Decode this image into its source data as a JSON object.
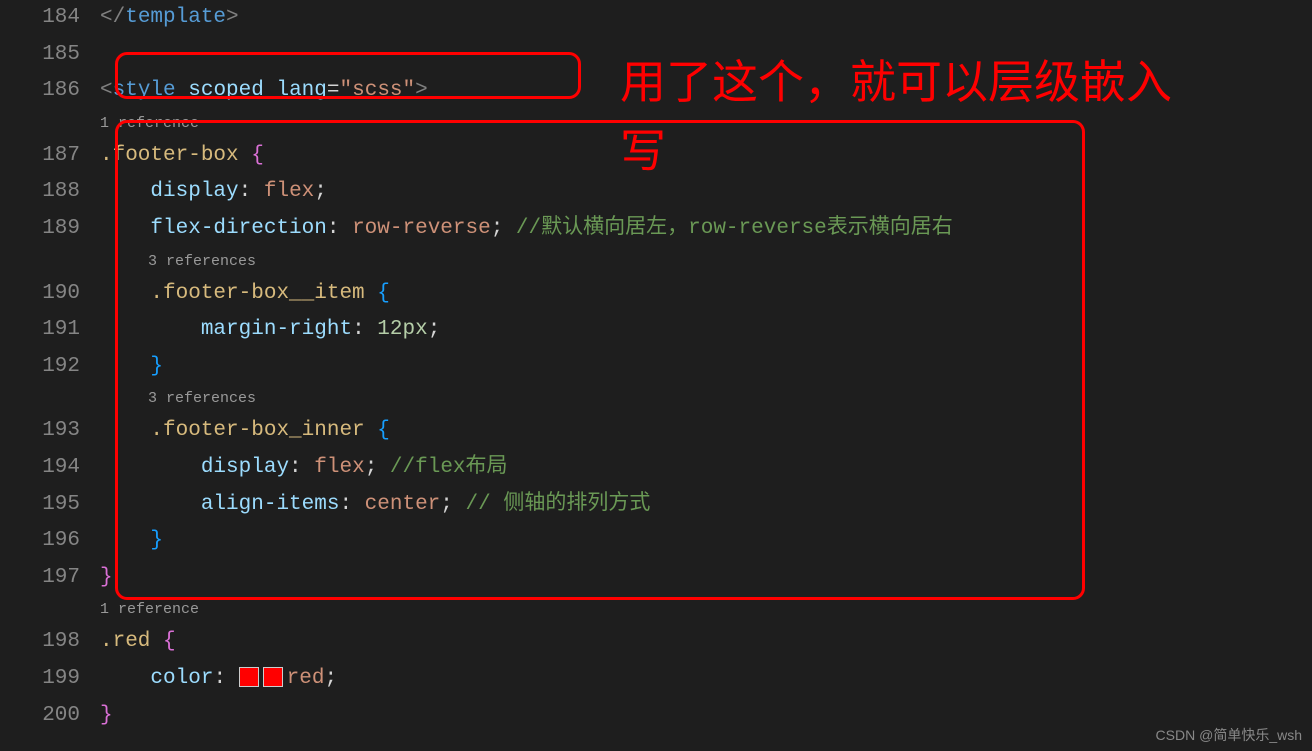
{
  "gutter": [
    "184",
    "185",
    "186",
    "",
    "187",
    "188",
    "189",
    "",
    "190",
    "191",
    "192",
    "",
    "193",
    "194",
    "195",
    "196",
    "197",
    "",
    "198",
    "199",
    "200"
  ],
  "codelens": {
    "ref1": "1 reference",
    "ref3a": "3 references",
    "ref3b": "3 references",
    "ref1b": "1 reference"
  },
  "code": {
    "l184": {
      "open": "</",
      "tag": "template",
      "close": ">"
    },
    "l186": {
      "open": "<",
      "tag": "style",
      "a1": "scoped",
      "a2": "lang",
      "eq": "=",
      "q": "\"",
      "v": "scss",
      "close": ">"
    },
    "l187": {
      "sel": ".footer-box",
      "sp": " ",
      "b": "{"
    },
    "l188": {
      "ind": "    ",
      "p": "display",
      "c": ": ",
      "v": "flex",
      "s": ";"
    },
    "l189": {
      "ind": "    ",
      "p": "flex-direction",
      "c": ": ",
      "v": "row-reverse",
      "s": ";",
      "sp": " ",
      "cm": "//默认横向居左，row-reverse表示横向居右"
    },
    "l190": {
      "ind": "    ",
      "sel": ".footer-box__item",
      "sp": " ",
      "b": "{"
    },
    "l191": {
      "ind": "        ",
      "p": "margin-right",
      "c": ": ",
      "v": "12px",
      "s": ";"
    },
    "l192": {
      "ind": "    ",
      "b": "}"
    },
    "l193": {
      "ind": "    ",
      "sel": ".footer-box_inner",
      "sp": " ",
      "b": "{"
    },
    "l194": {
      "ind": "        ",
      "p": "display",
      "c": ": ",
      "v": "flex",
      "s": ";",
      "sp": " ",
      "cm": "//flex布局"
    },
    "l195": {
      "ind": "        ",
      "p": "align-items",
      "c": ": ",
      "v": "center",
      "s": ";",
      "sp": " ",
      "cm": "// 侧轴的排列方式"
    },
    "l196": {
      "ind": "    ",
      "b": "}"
    },
    "l197": {
      "b": "}"
    },
    "l198": {
      "sel": ".red",
      "sp": " ",
      "b": "{"
    },
    "l199": {
      "ind": "    ",
      "p": "color",
      "c": ": ",
      "swatch": "red",
      "v": "red",
      "s": ";"
    },
    "l200": {
      "b": "}"
    }
  },
  "annotation": {
    "text": "用了这个，就可以层级嵌入写"
  },
  "watermark": "CSDN @简单快乐_wsh"
}
